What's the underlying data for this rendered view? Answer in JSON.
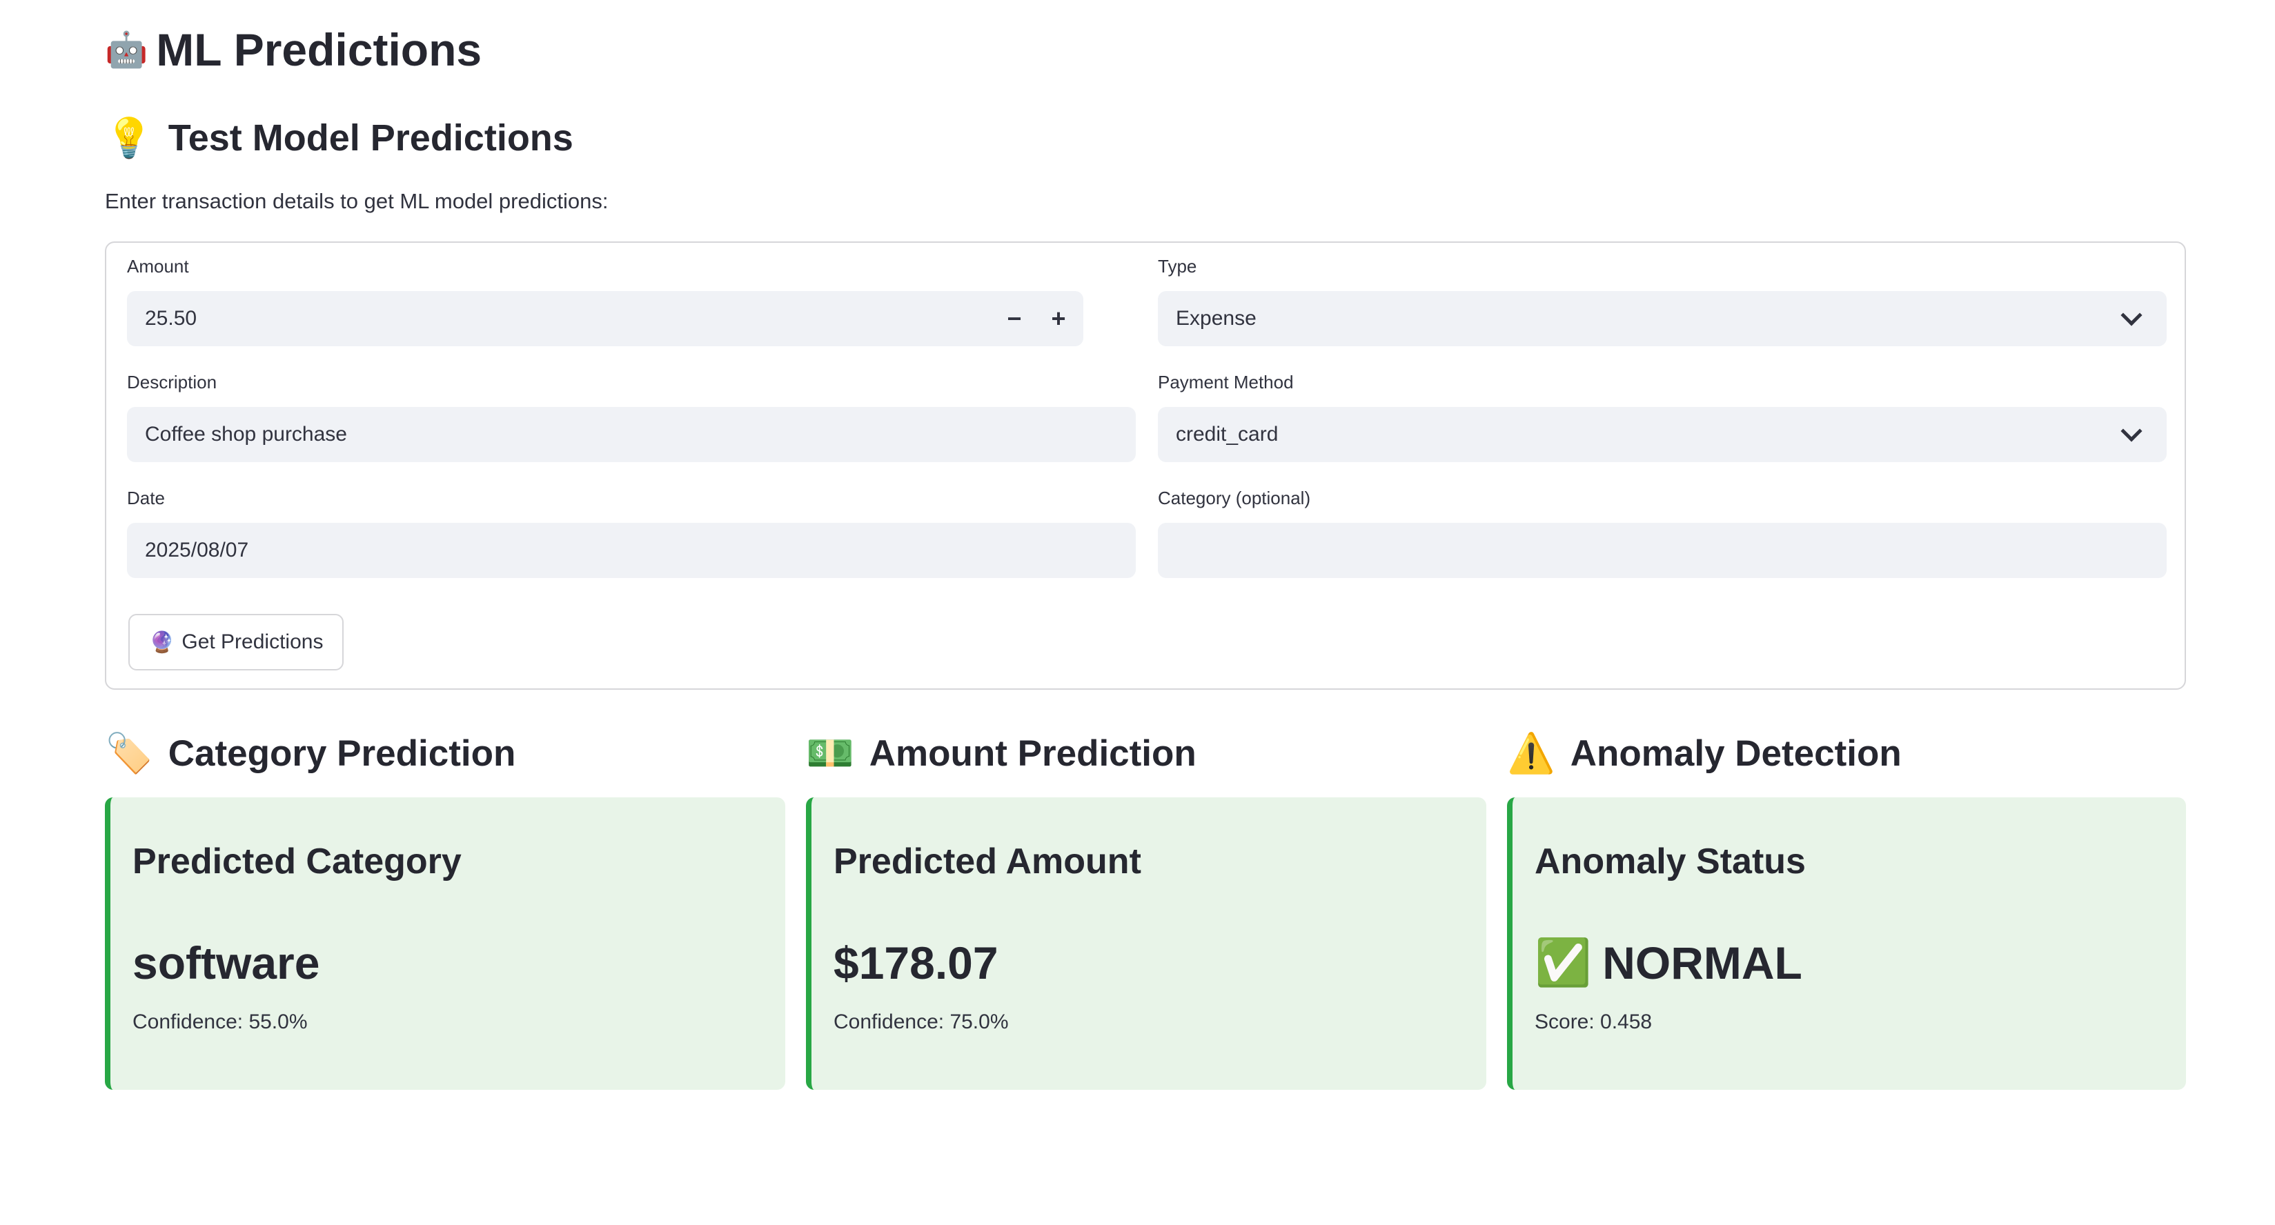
{
  "page": {
    "title_icon": "robot-face-icon",
    "title": "ML Predictions"
  },
  "test_section": {
    "icon": "light-bulb-icon",
    "heading": "Test Model Predictions",
    "intro": "Enter transaction details to get ML model predictions:"
  },
  "form": {
    "amount": {
      "label": "Amount",
      "value": "25.50",
      "decrement": "−",
      "increment": "+"
    },
    "type": {
      "label": "Type",
      "value": "Expense"
    },
    "description": {
      "label": "Description",
      "value": "Coffee shop purchase"
    },
    "payment_method": {
      "label": "Payment Method",
      "value": "credit_card"
    },
    "date": {
      "label": "Date",
      "value": "2025/08/07"
    },
    "category": {
      "label": "Category (optional)",
      "value": ""
    },
    "submit": {
      "icon": "crystal-ball-icon",
      "label": "Get Predictions"
    }
  },
  "results": {
    "category": {
      "icon": "label-tag-icon",
      "heading": "Category Prediction",
      "card_title": "Predicted Category",
      "value": "software",
      "detail": "Confidence: 55.0%"
    },
    "amount": {
      "icon": "dollar-banknote-icon",
      "heading": "Amount Prediction",
      "card_title": "Predicted Amount",
      "value": "$178.07",
      "detail": "Confidence: 75.0%"
    },
    "anomaly": {
      "icon": "warning-icon",
      "heading": "Anomaly Detection",
      "card_title": "Anomaly Status",
      "status_icon": "check-mark-icon",
      "value": "NORMAL",
      "detail": "Score: 0.458"
    }
  },
  "colors": {
    "card_background": "#e8f4e8",
    "card_accent": "#28a745",
    "input_background": "#f0f2f6",
    "text": "#262730"
  }
}
